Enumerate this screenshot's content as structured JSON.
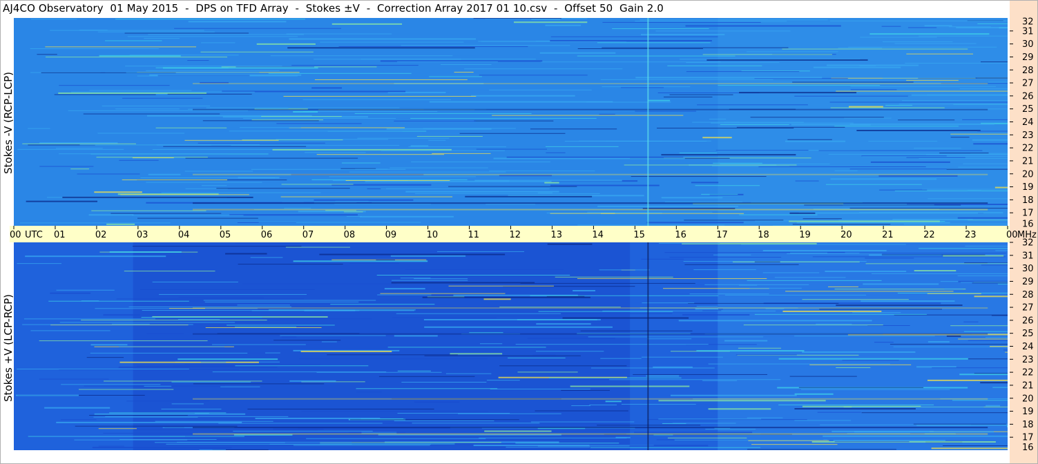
{
  "title": "AJ4CO Observatory  01 May 2015  -  DPS on TFD Array  -  Stokes ±V  -  Correction Array 2017 01 10.csv  -  Offset 50  Gain 2.0",
  "colors": {
    "background_low": "#1a5ad8",
    "background_mid": "#2a8ee8",
    "hot": "#f5e34a",
    "cold": "#0a1a5a",
    "axis_band": "#ffffc8",
    "freq_band": "#fde0c8"
  },
  "chart_data": [
    {
      "type": "heatmap",
      "name": "panel-top",
      "ylabel": "Stokes -V (RCP-LCP)",
      "xlim_utc_hours": [
        0,
        24
      ],
      "ylim_mhz": [
        16,
        32
      ],
      "y_ticks": [
        "16",
        "17",
        "18",
        "19",
        "20",
        "21",
        "22",
        "23",
        "24",
        "25",
        "26",
        "27",
        "28",
        "29",
        "30",
        "31",
        "32"
      ]
    },
    {
      "type": "heatmap",
      "name": "panel-bottom",
      "ylabel": "Stokes +V (LCP-RCP)",
      "xlim_utc_hours": [
        0,
        24
      ],
      "ylim_mhz": [
        16,
        32
      ],
      "y_ticks": [
        "16",
        "17",
        "18",
        "19",
        "20",
        "21",
        "22",
        "23",
        "24",
        "25",
        "26",
        "27",
        "28",
        "29",
        "30",
        "31",
        "32"
      ]
    }
  ],
  "time_axis": {
    "ticks": [
      "00",
      "01",
      "02",
      "03",
      "04",
      "05",
      "06",
      "07",
      "08",
      "09",
      "10",
      "11",
      "12",
      "13",
      "14",
      "15",
      "16",
      "17",
      "18",
      "19",
      "20",
      "21",
      "22",
      "23",
      "00"
    ],
    "utc_label": "UTC",
    "mhz_label": "MHz"
  }
}
